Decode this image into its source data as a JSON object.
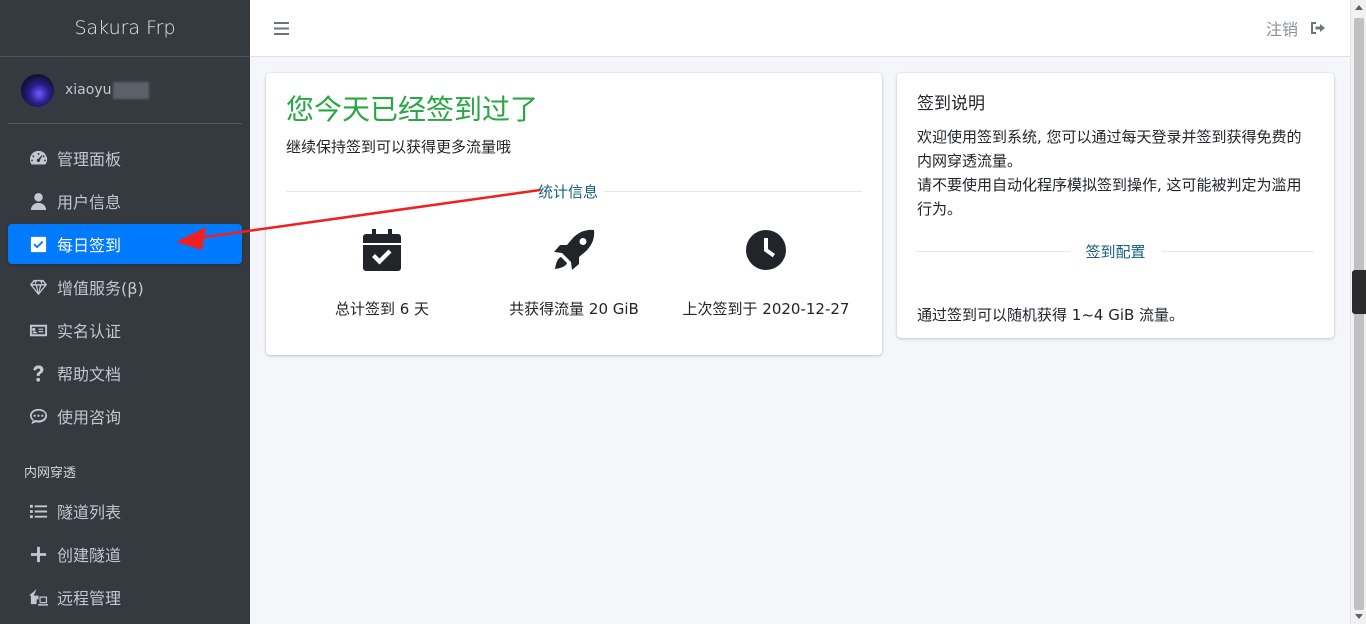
{
  "brand": "Sakura Frp",
  "user": {
    "name": "xiaoyu"
  },
  "nav": [
    {
      "label": "管理面板",
      "icon": "dashboard-icon",
      "active": false
    },
    {
      "label": "用户信息",
      "icon": "user-icon",
      "active": false
    },
    {
      "label": "每日签到",
      "icon": "check-square-icon",
      "active": true
    },
    {
      "label": "增值服务(β)",
      "icon": "gem-icon",
      "active": false
    },
    {
      "label": "实名认证",
      "icon": "id-card-icon",
      "active": false
    },
    {
      "label": "帮助文档",
      "icon": "question-icon",
      "active": false
    },
    {
      "label": "使用咨询",
      "icon": "comment-dots-icon",
      "active": false
    }
  ],
  "nav_section": "内网穿透",
  "nav2": [
    {
      "label": "隧道列表",
      "icon": "list-icon"
    },
    {
      "label": "创建隧道",
      "icon": "plus-icon"
    },
    {
      "label": "远程管理",
      "icon": "house-laptop-icon"
    }
  ],
  "topbar": {
    "logout_label": "注销"
  },
  "checkin": {
    "title": "您今天已经签到过了",
    "subtitle": "继续保持签到可以获得更多流量哦",
    "stats_label": "统计信息",
    "stats": [
      {
        "icon": "calendar-check-icon",
        "text": "总计签到 6 天"
      },
      {
        "icon": "rocket-icon",
        "text": "共获得流量 20 GiB"
      },
      {
        "icon": "clock-icon",
        "text": "上次签到于 2020-12-27"
      }
    ]
  },
  "info": {
    "title": "签到说明",
    "body1": "欢迎使用签到系统, 您可以通过每天登录并签到获得免费的内网穿透流量。",
    "body2": "请不要使用自动化程序模拟签到操作, 这可能被判定为滥用行为。",
    "config_label": "签到配置",
    "footer": "通过签到可以随机获得 1~4 GiB 流量。"
  },
  "colors": {
    "sidebar": "#343a40",
    "active": "#007bff",
    "success": "#28a745",
    "annotation": "#f02020"
  }
}
